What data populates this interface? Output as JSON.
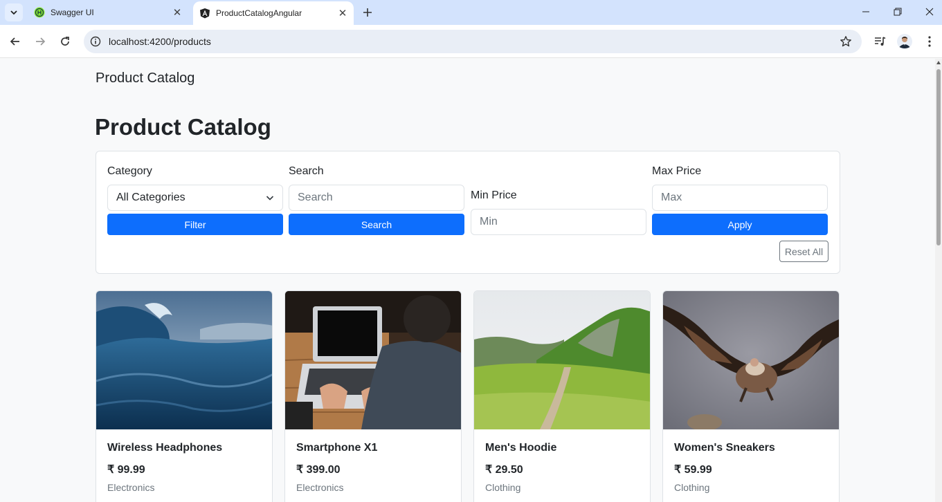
{
  "browser": {
    "tabs": [
      {
        "title": "Swagger UI",
        "active": false
      },
      {
        "title": "ProductCatalogAngular",
        "active": true
      }
    ],
    "url": "localhost:4200/products"
  },
  "page": {
    "brand": "Product Catalog",
    "heading": "Product Catalog",
    "filters": {
      "category_label": "Category",
      "category_value": "All Categories",
      "filter_button": "Filter",
      "search_label": "Search",
      "search_placeholder": "Search",
      "search_button": "Search",
      "min_label": "Min Price",
      "min_placeholder": "Min",
      "max_label": "Max Price",
      "max_placeholder": "Max",
      "apply_button": "Apply",
      "reset_button": "Reset All"
    },
    "products": [
      {
        "name": "Wireless Headphones",
        "price": "₹ 99.99",
        "category": "Electronics",
        "image": "ocean-wave-photo"
      },
      {
        "name": "Smartphone X1",
        "price": "₹ 399.00",
        "category": "Electronics",
        "image": "laptop-typing-photo"
      },
      {
        "name": "Men's Hoodie",
        "price": "₹ 29.50",
        "category": "Clothing",
        "image": "green-mountain-photo"
      },
      {
        "name": "Women's Sneakers",
        "price": "₹ 59.99",
        "category": "Clothing",
        "image": "vulture-flying-photo"
      }
    ]
  },
  "colors": {
    "primary": "#0d6efd",
    "tabstrip": "#d3e3fd",
    "page_bg": "#f8f9fa"
  }
}
